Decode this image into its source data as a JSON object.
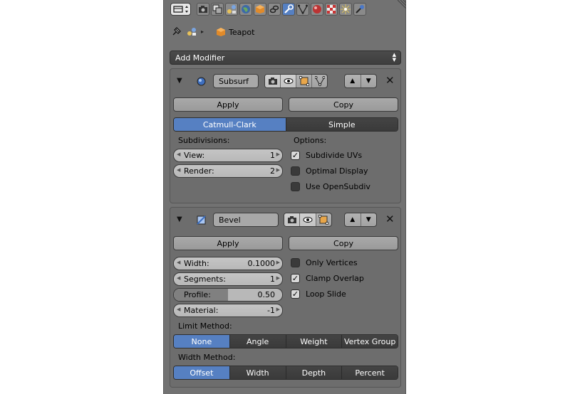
{
  "toolbar": {
    "icons": [
      "render-icon",
      "render-layers-icon",
      "scene-icon",
      "world-icon",
      "object-icon",
      "constraints-icon",
      "modifiers-icon",
      "data-icon",
      "material-icon",
      "texture-icon",
      "particles-icon",
      "physics-icon"
    ],
    "active": "modifiers-icon"
  },
  "context": {
    "object_name": "Teapot"
  },
  "add_modifier": {
    "label": "Add Modifier"
  },
  "subsurf": {
    "name": "Subsurf",
    "apply_label": "Apply",
    "copy_label": "Copy",
    "type_options": [
      "Catmull-Clark",
      "Simple"
    ],
    "type_selected": "Catmull-Clark",
    "subdivisions_label": "Subdivisions:",
    "view_label": "View:",
    "view_value": "1",
    "render_label": "Render:",
    "render_value": "2",
    "options_label": "Options:",
    "subdivide_uvs": {
      "label": "Subdivide UVs",
      "checked": true
    },
    "optimal_display": {
      "label": "Optimal Display",
      "checked": false
    },
    "use_opensubdiv": {
      "label": "Use OpenSubdiv",
      "checked": false
    }
  },
  "bevel": {
    "name": "Bevel",
    "apply_label": "Apply",
    "copy_label": "Copy",
    "width_label": "Width:",
    "width_value": "0.1000",
    "segments_label": "Segments:",
    "segments_value": "1",
    "profile_label": "Profile:",
    "profile_value": "0.50",
    "profile_fraction": 0.5,
    "material_label": "Material:",
    "material_value": "-1",
    "only_vertices": {
      "label": "Only Vertices",
      "checked": false
    },
    "clamp_overlap": {
      "label": "Clamp Overlap",
      "checked": true
    },
    "loop_slide": {
      "label": "Loop Slide",
      "checked": true
    },
    "limit_method_label": "Limit Method:",
    "limit_options": [
      "None",
      "Angle",
      "Weight",
      "Vertex Group"
    ],
    "limit_selected": "None",
    "width_method_label": "Width Method:",
    "width_options": [
      "Offset",
      "Width",
      "Depth",
      "Percent"
    ],
    "width_selected": "Offset"
  },
  "colors": {
    "accent": "#5680c2",
    "panel": "#727272",
    "box": "#6d6d6d"
  }
}
